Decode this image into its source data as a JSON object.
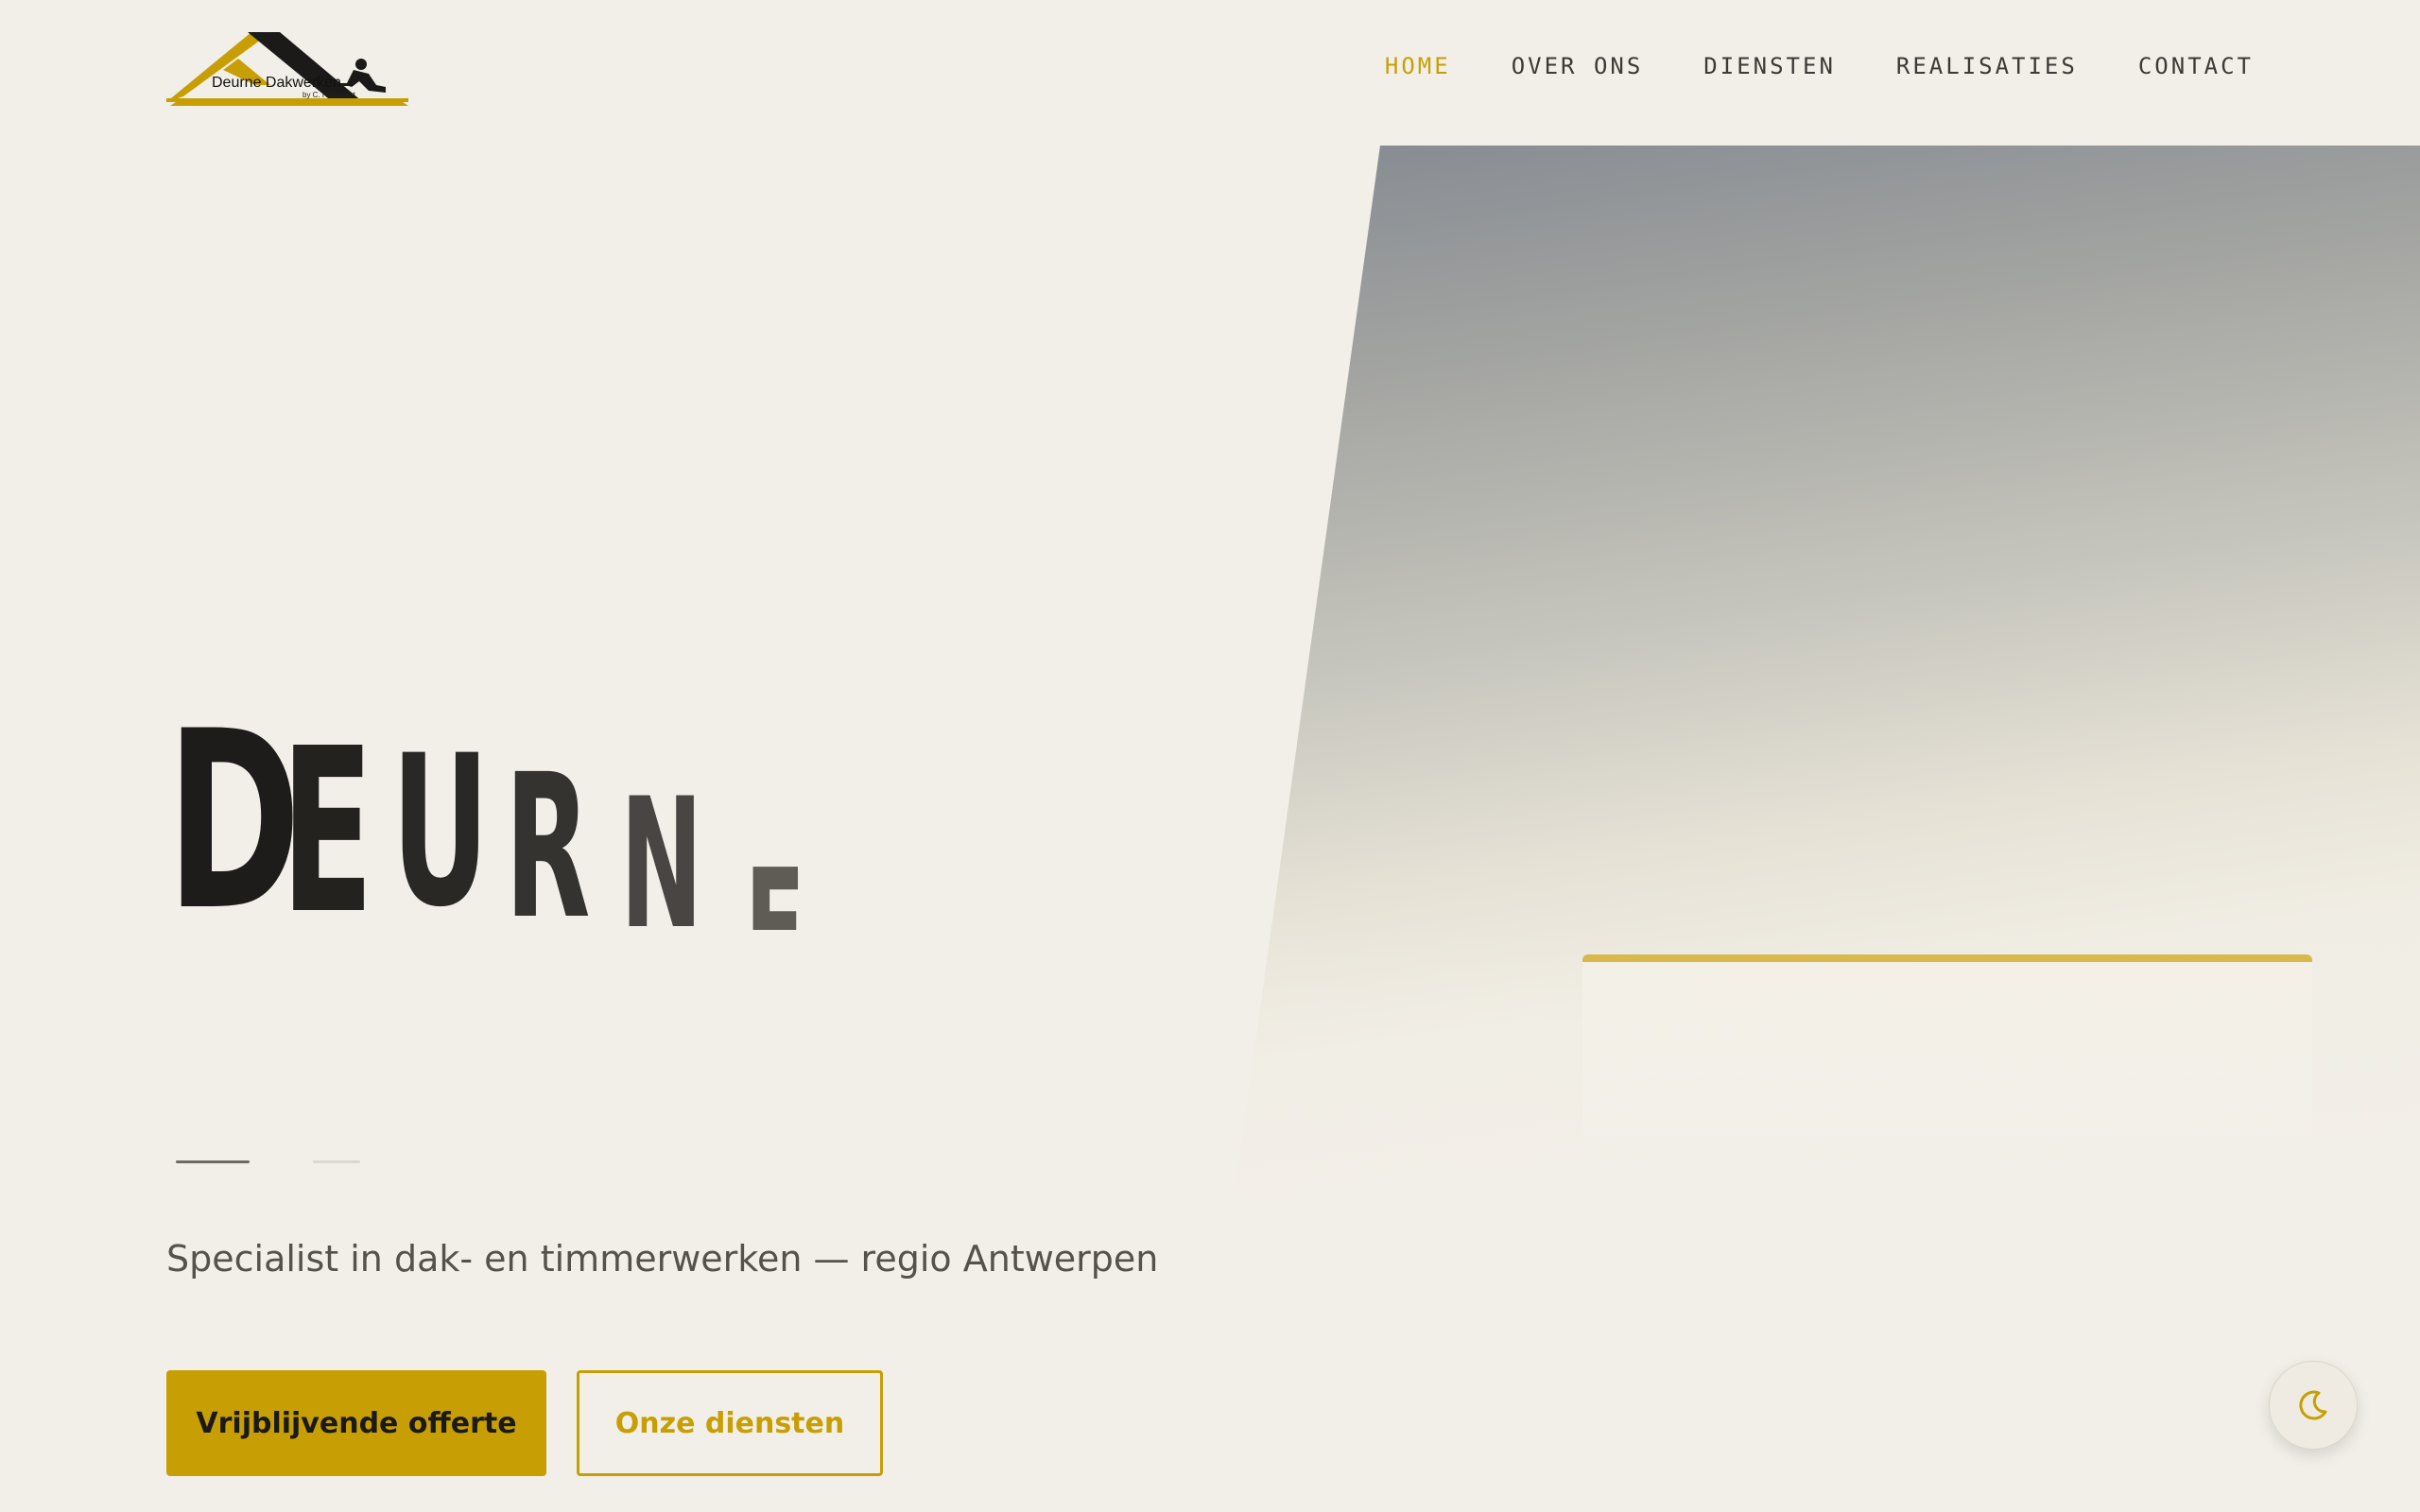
{
  "brand": {
    "name": "Deurne Dakwerken",
    "sub": "by C. Hillewaert",
    "logo_icon": "roof-worker-logo"
  },
  "nav": {
    "items": [
      {
        "label": "HOME",
        "active": true
      },
      {
        "label": "OVER ONS",
        "active": false
      },
      {
        "label": "DIENSTEN",
        "active": false
      },
      {
        "label": "REALISATIES",
        "active": false
      },
      {
        "label": "CONTACT",
        "active": false
      }
    ]
  },
  "hero": {
    "title_letters": [
      "D",
      "E",
      "U",
      "R",
      "N",
      "E"
    ],
    "tagline": "Specialist in dak- en timmerwerken — regio Antwerpen",
    "primary_cta": "Vrijblijvende offerte",
    "secondary_cta": "Onze diensten"
  },
  "theme_toggle": {
    "icon": "moon-icon"
  },
  "colors": {
    "accent": "#c79f05",
    "background": "#f2efe8",
    "text": "#1b1a18",
    "nav_text": "#3b3a37",
    "tagline": "#55524d"
  }
}
